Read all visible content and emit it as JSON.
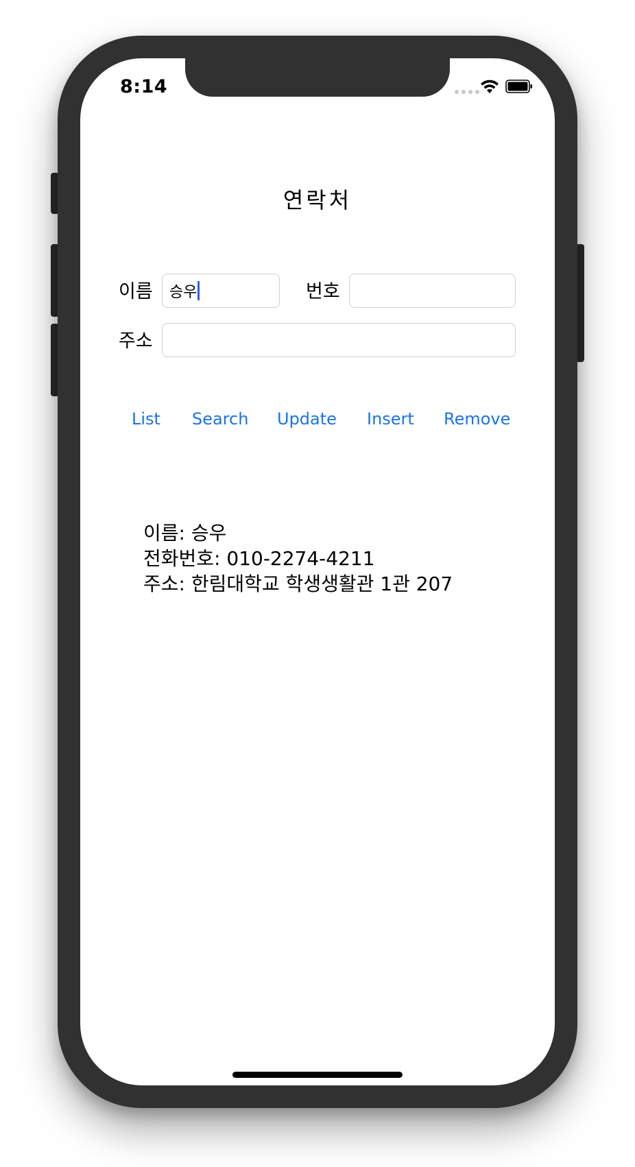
{
  "status_bar": {
    "time": "8:14",
    "signal_icon": "cellular-signal-icon",
    "wifi_icon": "wifi-icon",
    "battery_icon": "battery-icon"
  },
  "screen": {
    "title": "연락처"
  },
  "form": {
    "name_label": "이름",
    "name_value": "승우",
    "phone_label": "번호",
    "phone_value": "",
    "address_label": "주소",
    "address_value": ""
  },
  "actions": {
    "list": "List",
    "search": "Search",
    "update": "Update",
    "insert": "Insert",
    "remove": "Remove"
  },
  "result": {
    "line1": "이름: 승우",
    "line2": "전화번호: 010-2274-4211",
    "line3": "주소: 한림대학교 학생생활관 1관 207"
  },
  "colors": {
    "accent": "#1a73e8",
    "caret": "#2f5bea",
    "frame": "#313131"
  }
}
